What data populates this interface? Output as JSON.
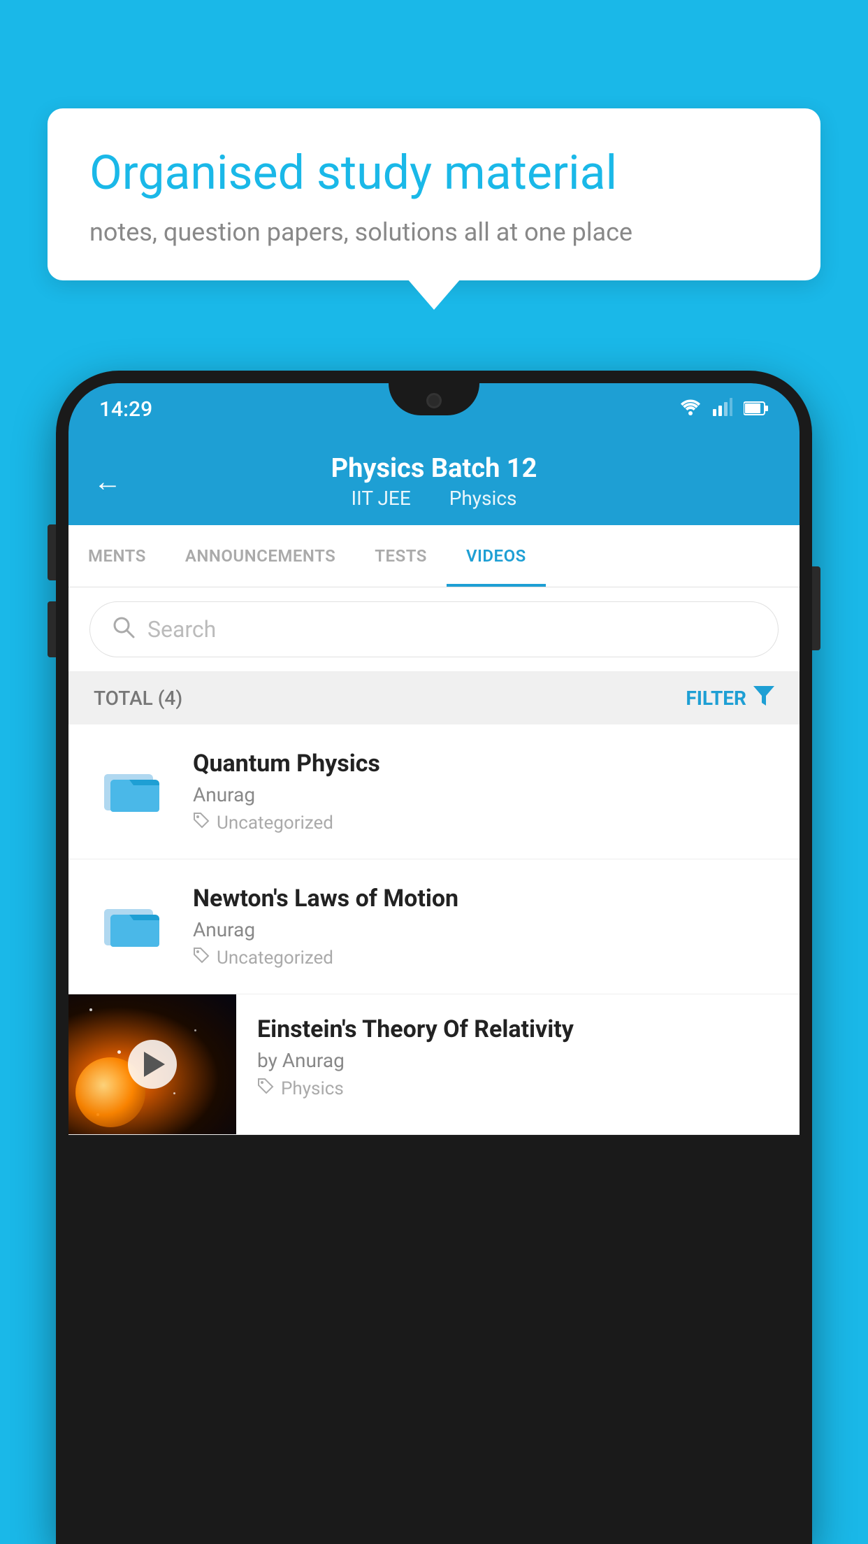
{
  "background": {
    "color": "#1ab8e8"
  },
  "speech_bubble": {
    "title": "Organised study material",
    "subtitle": "notes, question papers, solutions all at one place"
  },
  "phone": {
    "status_bar": {
      "time": "14:29"
    },
    "header": {
      "title": "Physics Batch 12",
      "subtitle_part1": "IIT JEE",
      "subtitle_part2": "Physics",
      "back_label": "←"
    },
    "tabs": [
      {
        "label": "MENTS",
        "active": false
      },
      {
        "label": "ANNOUNCEMENTS",
        "active": false
      },
      {
        "label": "TESTS",
        "active": false
      },
      {
        "label": "VIDEOS",
        "active": true
      }
    ],
    "search": {
      "placeholder": "Search"
    },
    "filter_bar": {
      "total_label": "TOTAL (4)",
      "filter_label": "FILTER"
    },
    "videos": [
      {
        "id": 1,
        "title": "Quantum Physics",
        "author": "Anurag",
        "tag": "Uncategorized",
        "has_thumbnail": false
      },
      {
        "id": 2,
        "title": "Newton's Laws of Motion",
        "author": "Anurag",
        "tag": "Uncategorized",
        "has_thumbnail": false
      },
      {
        "id": 3,
        "title": "Einstein's Theory Of Relativity",
        "author": "by Anurag",
        "tag": "Physics",
        "has_thumbnail": true
      }
    ]
  }
}
